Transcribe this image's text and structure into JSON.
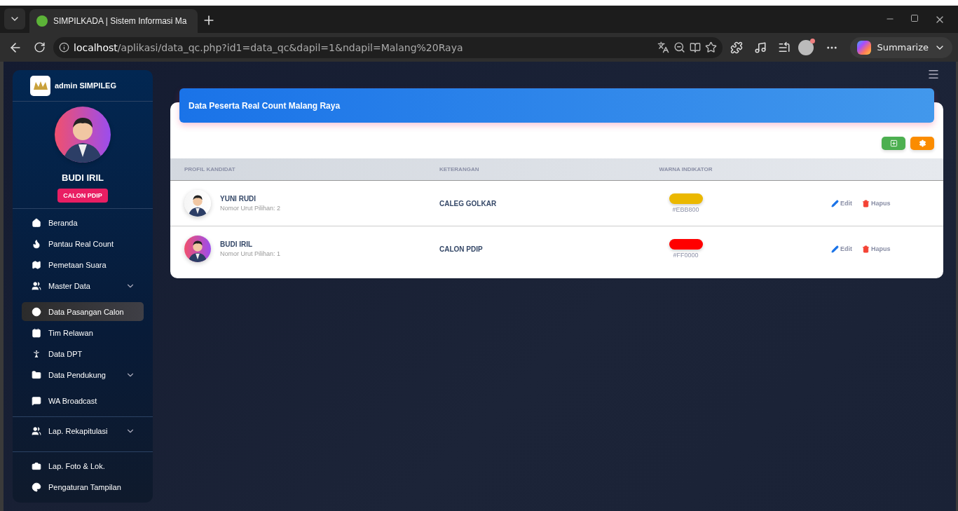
{
  "browser": {
    "tabs": [
      {
        "title": "SIMPILKADA | Sistem Informasi Ma",
        "selected": true
      }
    ],
    "url": {
      "host": "localhost",
      "path": "/aplikasi/data_qc.php?id1=data_qc&dapil=1&ndapil=Malang%20Raya"
    },
    "summarize_label": "Summarize"
  },
  "sidebar": {
    "brand": "admin SIMPILEG",
    "profile": {
      "name": "BUDI IRIL",
      "badge": "CALON PDIP"
    },
    "sections": [
      [
        {
          "label": "Beranda",
          "kind": "link",
          "selected": false
        },
        {
          "label": "Pantau Real Count",
          "kind": "link",
          "selected": false
        },
        {
          "label": "Pemetaan Suara",
          "kind": "link",
          "selected": false
        },
        {
          "label": "Master Data",
          "kind": "group",
          "expanded": false
        },
        {
          "label": "Data Pasangan Calon",
          "kind": "link",
          "selected": true
        },
        {
          "label": "Tim Relawan",
          "kind": "link",
          "selected": false
        },
        {
          "label": "Data DPT",
          "kind": "link",
          "selected": false
        },
        {
          "label": "Data Pendukung",
          "kind": "group",
          "expanded": false
        },
        {
          "label": "WA Broadcast",
          "kind": "link",
          "selected": false
        }
      ],
      [
        {
          "label": "Lap. Rekapitulasi",
          "kind": "group",
          "expanded": false
        }
      ],
      [
        {
          "label": "Lap. Foto & Lok.",
          "kind": "link",
          "selected": false
        },
        {
          "label": "Pengaturan Tampilan",
          "kind": "link",
          "selected": false
        }
      ]
    ]
  },
  "card": {
    "title": "Data Peserta Real Count **Malang Raya**",
    "table": {
      "columns": [
        "PROFIL KANDIDAT",
        "KETERANGAN",
        "WARNA INDIKATOR"
      ],
      "rows": [
        {
          "name": "YUNI RUDI",
          "subtitle": "Nomor Urut Pilihan: 2",
          "note": "CALEG GOLKAR",
          "color": "#ebb800",
          "color_label": "#EBB800",
          "actions": [
            "Edit",
            "Hapus"
          ]
        },
        {
          "name": "BUDI IRIL",
          "subtitle": "Nomor Urut Pilihan: 1",
          "note": "CALON PDIP",
          "color": "#ff0000",
          "color_label": "#FF0000",
          "actions": [
            "Edit",
            "Hapus"
          ]
        }
      ]
    }
  }
}
